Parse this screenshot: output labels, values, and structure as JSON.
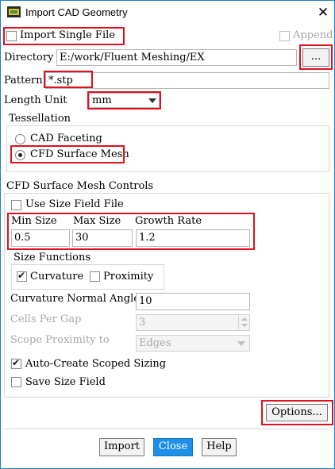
{
  "window": {
    "title": "Import CAD Geometry",
    "accent": "#1e7fc9"
  },
  "top": {
    "import_single_file": {
      "label": "Import Single File",
      "checked": false
    },
    "append": {
      "label": "Append",
      "checked": false,
      "enabled": false
    }
  },
  "directory": {
    "label": "Directory",
    "value": "E:/work/Fluent Meshing/EX",
    "browse_label": "..."
  },
  "pattern": {
    "label": "Pattern",
    "value": "*.stp"
  },
  "length_unit": {
    "label": "Length Unit",
    "selected": "mm"
  },
  "tessellation": {
    "label": "Tessellation",
    "options": [
      {
        "label": "CAD Faceting",
        "selected": false
      },
      {
        "label": "CFD Surface Mesh",
        "selected": true
      }
    ]
  },
  "mesh_controls": {
    "label": "CFD Surface Mesh Controls",
    "use_size_field_file": {
      "label": "Use Size Field File",
      "checked": false
    },
    "min_size": {
      "label": "Min Size",
      "value": "0.5"
    },
    "max_size": {
      "label": "Max Size",
      "value": "30"
    },
    "growth_rate": {
      "label": "Growth Rate",
      "value": "1.2"
    },
    "size_functions": {
      "label": "Size Functions",
      "curvature": {
        "label": "Curvature",
        "checked": true
      },
      "proximity": {
        "label": "Proximity",
        "checked": false
      }
    },
    "curvature_normal_angle": {
      "label": "Curvature Normal Angle",
      "value": "10"
    },
    "cells_per_gap": {
      "label": "Cells Per Gap",
      "value": "3",
      "enabled": false
    },
    "scope_proximity_to": {
      "label": "Scope Proximity to",
      "value": "Edges",
      "enabled": false
    },
    "auto_create_scoped_sizing": {
      "label": "Auto-Create Scoped Sizing",
      "checked": true
    },
    "save_size_field": {
      "label": "Save Size Field",
      "checked": false
    }
  },
  "options_button": "Options...",
  "footer": {
    "import": "Import",
    "close": "Close",
    "help": "Help"
  },
  "colors": {
    "highlight": "#e0101e",
    "primary_button": "#1e90e8"
  }
}
